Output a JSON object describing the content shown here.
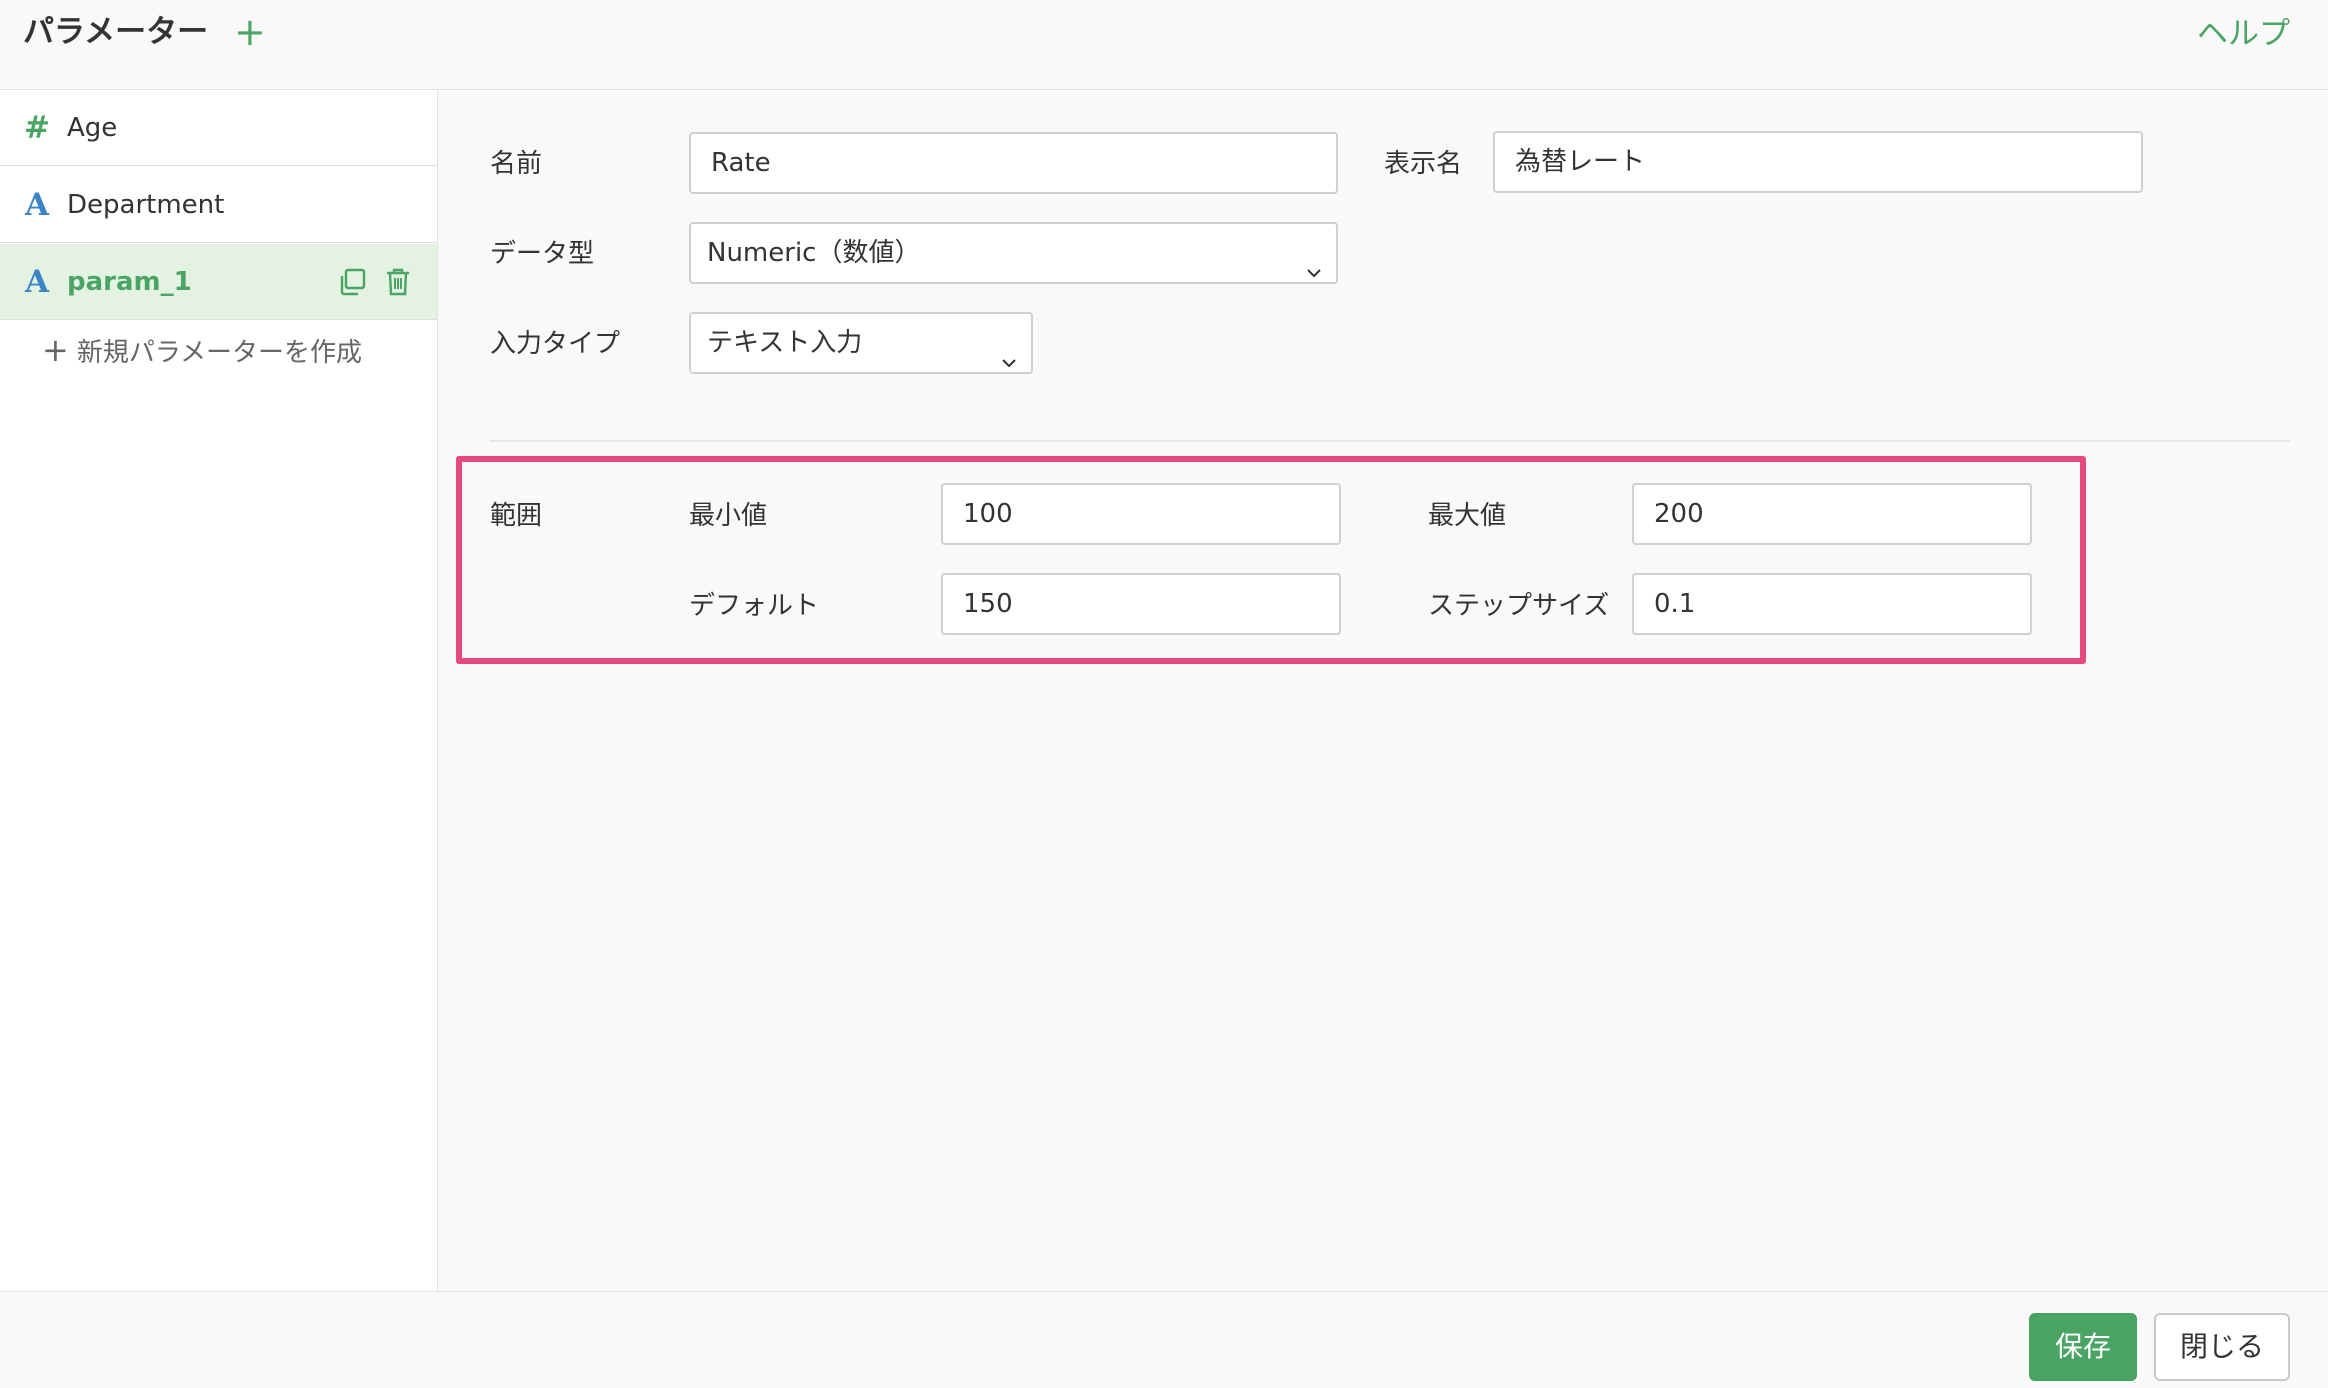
{
  "header": {
    "title": "パラメーター",
    "add_symbol": "+",
    "help_label": "ヘルプ"
  },
  "sidebar": {
    "items": [
      {
        "icon": "#",
        "label": "Age",
        "type": "number"
      },
      {
        "icon": "A",
        "label": "Department",
        "type": "string"
      },
      {
        "icon": "A",
        "label": "param_1",
        "type": "string",
        "active": true
      }
    ],
    "new_param_symbol": "+",
    "new_param_label": "新規パラメーターを作成"
  },
  "form": {
    "name_label": "名前",
    "name_value": "Rate",
    "display_name_label": "表示名",
    "display_name_value": "為替レート",
    "data_type_label": "データ型",
    "data_type_value": "Numeric（数値）",
    "input_type_label": "入力タイプ",
    "input_type_value": "テキスト入力",
    "range_label": "範囲",
    "min_label": "最小値",
    "min_value": "100",
    "max_label": "最大値",
    "max_value": "200",
    "default_label": "デフォルト",
    "default_value": "150",
    "step_label": "ステップサイズ",
    "step_value": "0.1"
  },
  "footer": {
    "save_label": "保存",
    "close_label": "閉じる"
  },
  "colors": {
    "accent_green": "#4aa564",
    "string_blue": "#3b84c5",
    "highlight_pink": "#e5487a"
  }
}
